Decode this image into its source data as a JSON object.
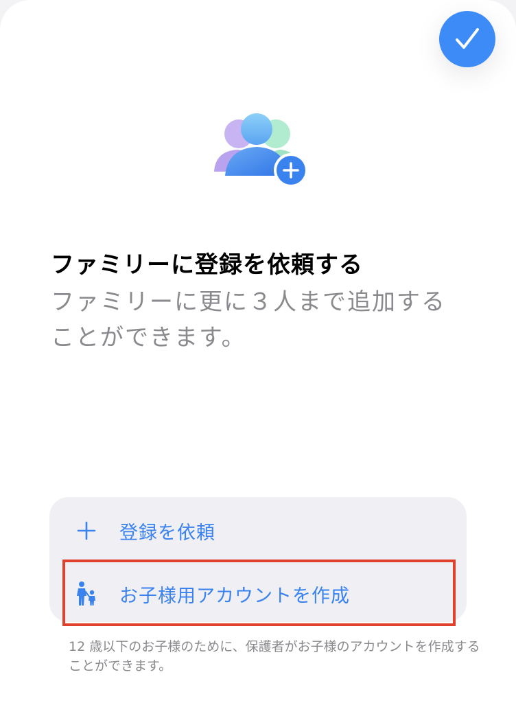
{
  "done_button": {
    "icon": "checkmark-icon",
    "color": "#3d8bf6"
  },
  "hero": {
    "icon": "family-add-icon"
  },
  "title": "ファミリーに登録を依頼する",
  "subtitle": "ファミリーに更に３人まで追加することができます。",
  "options": [
    {
      "icon": "plus-icon",
      "label": "登録を依頼"
    },
    {
      "icon": "child-account-icon",
      "label": "お子様用アカウントを作成"
    }
  ],
  "footnote": "12 歳以下のお子様のために、保護者がお子様のアカウントを作成することができます。",
  "colors": {
    "accent": "#3a82ee",
    "highlight": "#e0412d",
    "secondary_text": "#8a8a8e",
    "card_background": "#efeff4"
  }
}
